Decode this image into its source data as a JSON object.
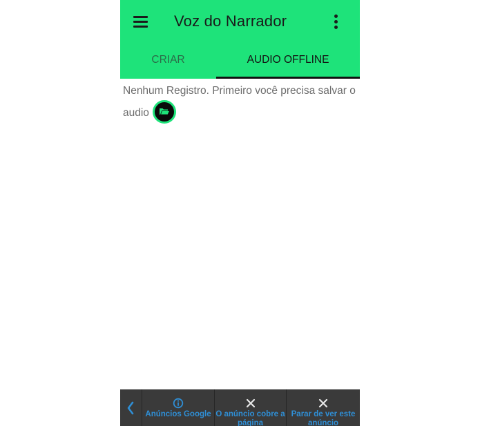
{
  "app": {
    "title": "Voz do Narrador"
  },
  "icons": {
    "menu": "hamburger-menu-icon",
    "overflow": "more-vertical-icon",
    "folder": "folder-open-icon",
    "back": "chevron-left-icon",
    "info": "info-circle-icon",
    "close": "close-icon"
  },
  "tabs": [
    {
      "label": "CRIAR",
      "selected": false
    },
    {
      "label": "AUDIO OFFLINE",
      "selected": true
    }
  ],
  "content": {
    "message": "Nenhum Registro. Primeiro você precisa salvar o audio"
  },
  "ad_bar": {
    "info_label": "Anúncios Google",
    "covers_label": "O anúncio cobre a página",
    "stop_label": "Parar de ver este anúncio"
  },
  "colors": {
    "accent": "#1ee37a",
    "tab_active_text": "#141414",
    "tab_inactive_text": "#2b6b48",
    "ad_bar_background": "#3a3a3a",
    "ad_link": "#2f8fd6"
  }
}
